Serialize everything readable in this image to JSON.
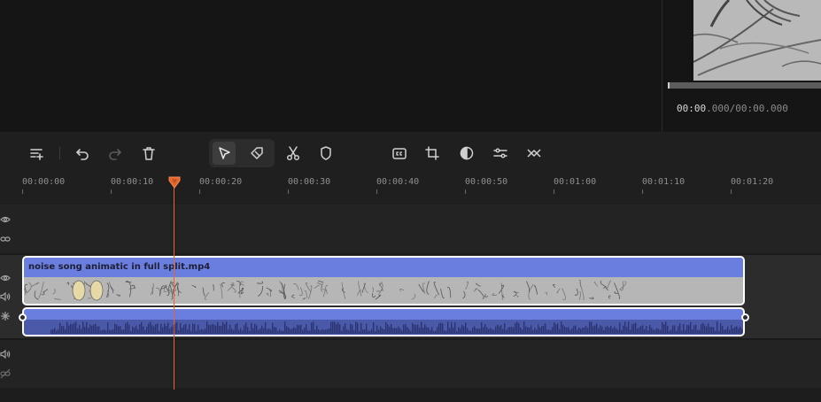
{
  "preview": {
    "current_time": "00:00",
    "current_time_ms": ".000",
    "total_time": "/00:00.000"
  },
  "toolbar": {
    "buttons": [
      {
        "name": "add-track-button",
        "icon": "add-track-icon"
      },
      {
        "name": "undo-button",
        "icon": "undo-icon"
      },
      {
        "name": "redo-button",
        "icon": "redo-icon"
      },
      {
        "name": "delete-button",
        "icon": "trash-icon"
      },
      {
        "name": "select-tool-button",
        "icon": "cursor-arrow-icon"
      },
      {
        "name": "blade-tool-button",
        "icon": "tag-icon"
      },
      {
        "name": "split-button",
        "icon": "scissors-icon"
      },
      {
        "name": "mask-button",
        "icon": "shield-icon"
      },
      {
        "name": "captions-button",
        "icon": "cc-icon"
      },
      {
        "name": "crop-button",
        "icon": "crop-icon"
      },
      {
        "name": "color-button",
        "icon": "contrast-icon"
      },
      {
        "name": "adjust-button",
        "icon": "sliders-icon"
      },
      {
        "name": "transition-button",
        "icon": "transition-icon"
      }
    ]
  },
  "ruler": {
    "labels": [
      "00:00:00",
      "00:00:10",
      "00:00:20",
      "00:00:30",
      "00:00:40",
      "00:00:50",
      "00:01:00",
      "00:01:10",
      "00:01:20"
    ]
  },
  "timeline": {
    "clip_title": "noise song animatic in full split.mp4",
    "playhead_time": "00:00:17"
  },
  "colors": {
    "accent": "#e8642a",
    "clip": "#6a7ee0",
    "selection": "#ffffff",
    "badge": "#8e7cff"
  }
}
